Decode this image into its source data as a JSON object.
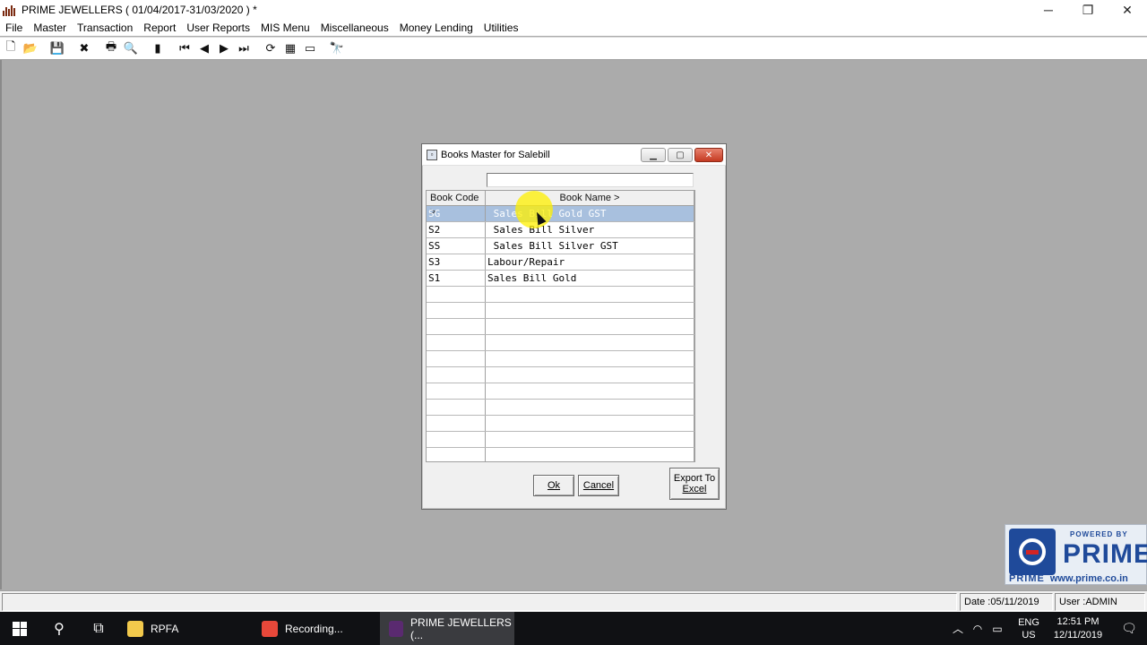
{
  "window": {
    "title": "PRIME JEWELLERS ( 01/04/2017-31/03/2020 ) *",
    "controls": {
      "minimize": "─",
      "restore": "❐",
      "close": "✕"
    }
  },
  "menu": {
    "items": [
      "File",
      "Master",
      "Transaction",
      "Report",
      "User Reports",
      "MIS Menu",
      "Miscellaneous",
      "Money Lending",
      "Utilities"
    ]
  },
  "toolbar": {
    "icons": [
      {
        "name": "new-icon",
        "glyph": "🗋"
      },
      {
        "name": "open-icon",
        "glyph": "📂"
      },
      {
        "name": "save-icon",
        "glyph": "💾"
      },
      {
        "name": "delete-icon",
        "glyph": "✖"
      },
      {
        "name": "print-icon",
        "glyph": "🖶"
      },
      {
        "name": "print-preview-icon",
        "glyph": "🔍"
      },
      {
        "name": "exit-icon",
        "glyph": "▮"
      },
      {
        "name": "first-record-icon",
        "glyph": "⏮"
      },
      {
        "name": "previous-record-icon",
        "glyph": "◀"
      },
      {
        "name": "next-record-icon",
        "glyph": "▶"
      },
      {
        "name": "last-record-icon",
        "glyph": "⏭"
      },
      {
        "name": "refresh-icon",
        "glyph": "⟳"
      },
      {
        "name": "calculator-icon",
        "glyph": "▦"
      },
      {
        "name": "screen-icon",
        "glyph": "▭"
      },
      {
        "name": "find-icon",
        "glyph": "🔭"
      }
    ]
  },
  "dialog": {
    "title": "Books Master for Salebill",
    "search": {
      "value": ""
    },
    "columns": {
      "code": "Book Code >",
      "name": "Book Name >"
    },
    "rows": [
      {
        "code": "SG",
        "name": " Sales Bill Gold GST",
        "selected": true
      },
      {
        "code": "S2",
        "name": " Sales Bill Silver",
        "selected": false
      },
      {
        "code": "SS",
        "name": " Sales Bill Silver GST",
        "selected": false
      },
      {
        "code": "S3",
        "name": "Labour/Repair",
        "selected": false
      },
      {
        "code": "S1",
        "name": "Sales Bill Gold",
        "selected": false
      }
    ],
    "empty_rows": 11,
    "buttons": {
      "ok": "Ok",
      "cancel": "Cancel",
      "export_line1": "Export To",
      "export_line2": "Excel"
    }
  },
  "logo": {
    "powered_by": "POWERED BY",
    "name": "PRIME",
    "brand": "PRIME",
    "url": "www.prime.co.in"
  },
  "status": {
    "main": "",
    "date": "Date :05/11/2019",
    "user": "User :ADMIN"
  },
  "taskbar": {
    "tasks": [
      {
        "label": "RPFA"
      },
      {
        "label": "Recording..."
      },
      {
        "label": "PRIME JEWELLERS (..."
      }
    ],
    "tray": {
      "lang_line1": "ENG",
      "lang_line2": "US",
      "time": "12:51 PM",
      "date": "12/11/2019"
    }
  },
  "colors": {
    "workspace": "#ababab",
    "selection": "#a8c0de",
    "taskbar": "#101114",
    "logo_blue": "#1f4a9a"
  }
}
